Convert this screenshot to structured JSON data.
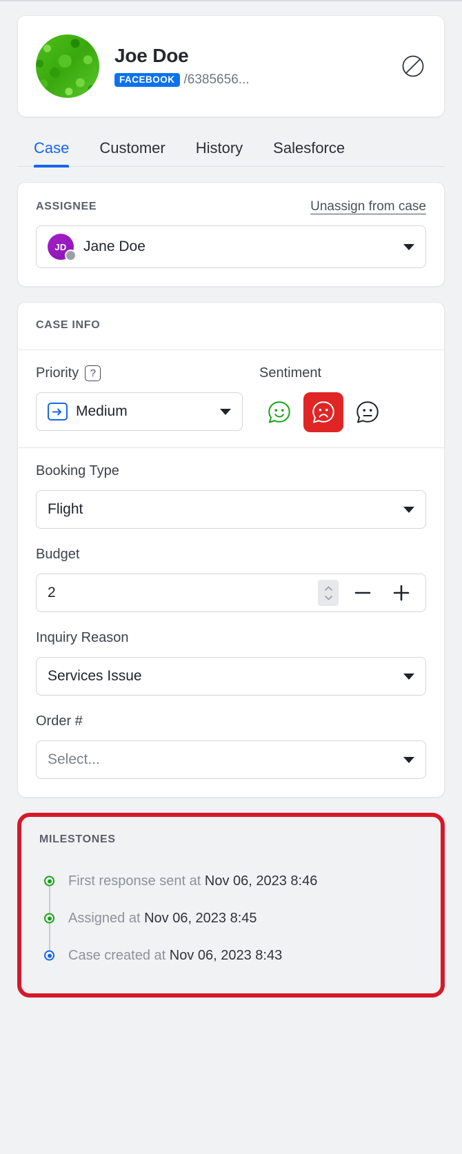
{
  "customer": {
    "name": "Joe Doe",
    "channel_badge": "FACEBOOK",
    "handle": "/6385656...",
    "block_icon": "block-icon",
    "avatar_alt": "customer-avatar"
  },
  "tabs": [
    {
      "label": "Case",
      "active": true
    },
    {
      "label": "Customer",
      "active": false
    },
    {
      "label": "History",
      "active": false
    },
    {
      "label": "Salesforce",
      "active": false
    }
  ],
  "assignee": {
    "title": "ASSIGNEE",
    "unassign_label": "Unassign from case",
    "agent_initials": "JD",
    "agent_name": "Jane Doe",
    "presence": "offline"
  },
  "case_info": {
    "title": "CASE INFO",
    "priority": {
      "label": "Priority",
      "help_glyph": "?",
      "value": "Medium",
      "icon": "arrow-right-box-icon"
    },
    "sentiment": {
      "label": "Sentiment",
      "options": [
        {
          "name": "positive",
          "glyph": "smiley",
          "selected": false,
          "color": "#16a215"
        },
        {
          "name": "negative",
          "glyph": "frowny",
          "selected": true,
          "color": "#ffffff"
        },
        {
          "name": "neutral",
          "glyph": "neutral",
          "selected": false,
          "color": "#1f2329"
        }
      ],
      "selected_bg": "#e02525"
    },
    "booking_type": {
      "label": "Booking Type",
      "value": "Flight"
    },
    "budget": {
      "label": "Budget",
      "value": "2",
      "decrement": "−",
      "increment": "+"
    },
    "inquiry_reason": {
      "label": "Inquiry Reason",
      "value": "Services Issue"
    },
    "order_number": {
      "label": "Order #",
      "value": "Select...",
      "is_placeholder": true
    }
  },
  "milestones": {
    "title": "MILESTONES",
    "highlight_color": "#d6192a",
    "items": [
      {
        "label": "First response sent at ",
        "timestamp": "Nov 06, 2023 8:46",
        "dot": "green"
      },
      {
        "label": "Assigned at ",
        "timestamp": "Nov 06, 2023 8:45",
        "dot": "green"
      },
      {
        "label": "Case created at ",
        "timestamp": "Nov 06, 2023 8:43",
        "dot": "blue"
      }
    ]
  }
}
